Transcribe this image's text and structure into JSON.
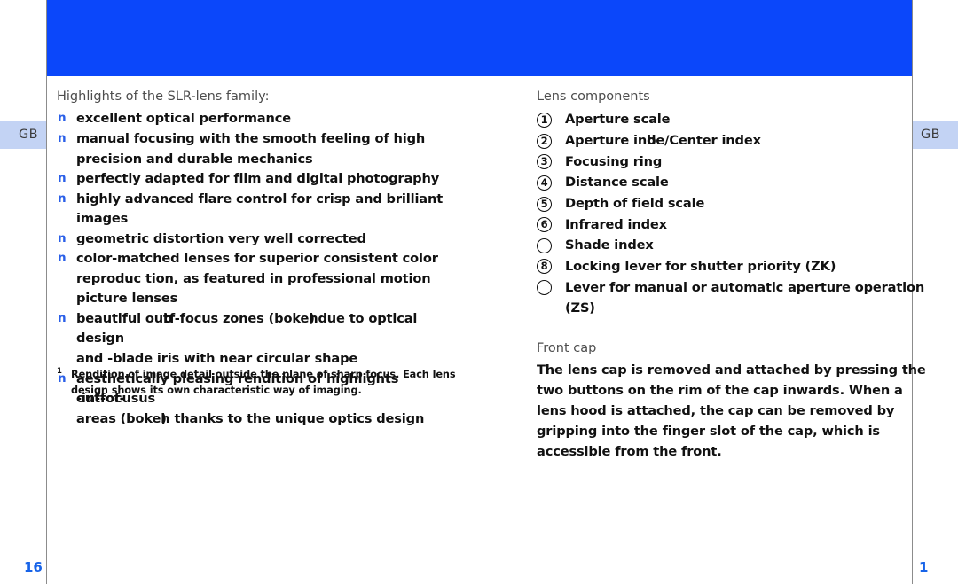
{
  "document": {
    "header_banner_color": "#0b47fa",
    "accent_color": "#1763e8",
    "bullet_color": "#2a5fe8",
    "tab_color": "#c3d3f4"
  },
  "tabs": {
    "left_label": "GB",
    "right_label": "GB"
  },
  "folios": {
    "left": "16",
    "right": "1"
  },
  "left_column": {
    "kicker": "Highlights of the SLR-lens family:",
    "bullet_glyph": "n",
    "items": [
      {
        "text": "excellent optical performance",
        "overlap": null
      },
      {
        "text": "manual focusing with the smooth feeling of high precision and durable mechanics",
        "overlap": null
      },
      {
        "text": "perfectly adapted for film and digital photography",
        "overlap": null
      },
      {
        "text": "highly advanced flare control for crisp and brilliant images",
        "overlap": null
      },
      {
        "text": "geometric distortion very well corrected",
        "overlap": null
      },
      {
        "text": "color-matched lenses for superior consistent color reproduc tion, as featured in professional motion picture lenses",
        "overlap": null
      },
      {
        "text": "beautiful out-of-focus zones (bokeh) due to optical design and  -blade iris with near circular shape",
        "overlap": {
          "prefix": "beautiful ou",
          "under": "t",
          "over": "b",
          "suffix": "f-focus zones (boke",
          "prefix2": "h",
          "under2": ")",
          "over2": "d",
          "suffix2": "ue to optical design",
          "line2": "and  -blade iris with near circular shape"
        }
      },
      {
        "text": "aesthetically pleasing rendition of highlights in out-of-focus areas (bokeh) thanks to the unique optics design",
        "overlap": {
          "prefix": "aesthetically pleasing rendition of highlights",
          "under": "-in-focus",
          "over": " out-of-",
          "suffix": "us",
          "line2_prefix": "areas (boke",
          "line2_under": "h",
          "line2_over": ")",
          "line2_suffix": " thanks to the unique optics design"
        }
      }
    ],
    "footnote": {
      "marker": "1",
      "text": "Rendition of image detail outside the plane of sharp focus. Each lens design shows its own characteristic way of imaging."
    }
  },
  "right_column": {
    "kicker": "Lens components",
    "components": [
      {
        "number": "1",
        "label": "Aperture scale"
      },
      {
        "number": "2",
        "label": "Aperture index/Center index"
      },
      {
        "number": "3",
        "label": "Focusing ring"
      },
      {
        "number": "4",
        "label": "Distance scale"
      },
      {
        "number": "5",
        "label": "Depth of field scale"
      },
      {
        "number": "6",
        "label": "Infrared index"
      },
      {
        "number": "",
        "label": "Shade index"
      },
      {
        "number": "8",
        "label": "Locking lever for shutter priority (ZK)"
      },
      {
        "number": "",
        "label": "Lever for manual or automatic aperture operation (ZS)"
      }
    ],
    "front_cap": {
      "kicker": "Front cap",
      "body": "The lens cap is removed and attached by pressing the two buttons on the rim of the cap inwards. When a lens hood is attached, the cap can be removed by gripping into the finger slot of the cap, which is accessible from the front."
    }
  }
}
